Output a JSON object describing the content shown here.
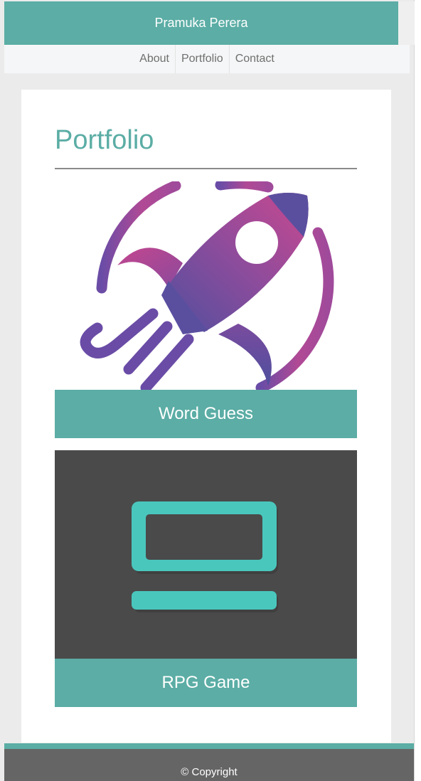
{
  "header": {
    "title": "Pramuka Perera"
  },
  "nav": {
    "items": [
      "About",
      "Portfolio",
      "Contact"
    ]
  },
  "main": {
    "heading": "Portfolio",
    "projects": [
      {
        "title": "Word Guess",
        "icon": "rocket-icon"
      },
      {
        "title": "RPG Game",
        "icon": "laptop-icon"
      }
    ]
  },
  "footer": {
    "text": "© Copyright"
  },
  "colors": {
    "accent": "#5bada5",
    "nav_bg": "#f5f6f7",
    "page_bg": "#ebebeb",
    "footer_bg": "#656565",
    "rocket_pink": "#c4468f",
    "rocket_purple": "#5a4f9f",
    "laptop_teal": "#4ac7bd",
    "thumb_dark": "#4a4a4a"
  }
}
